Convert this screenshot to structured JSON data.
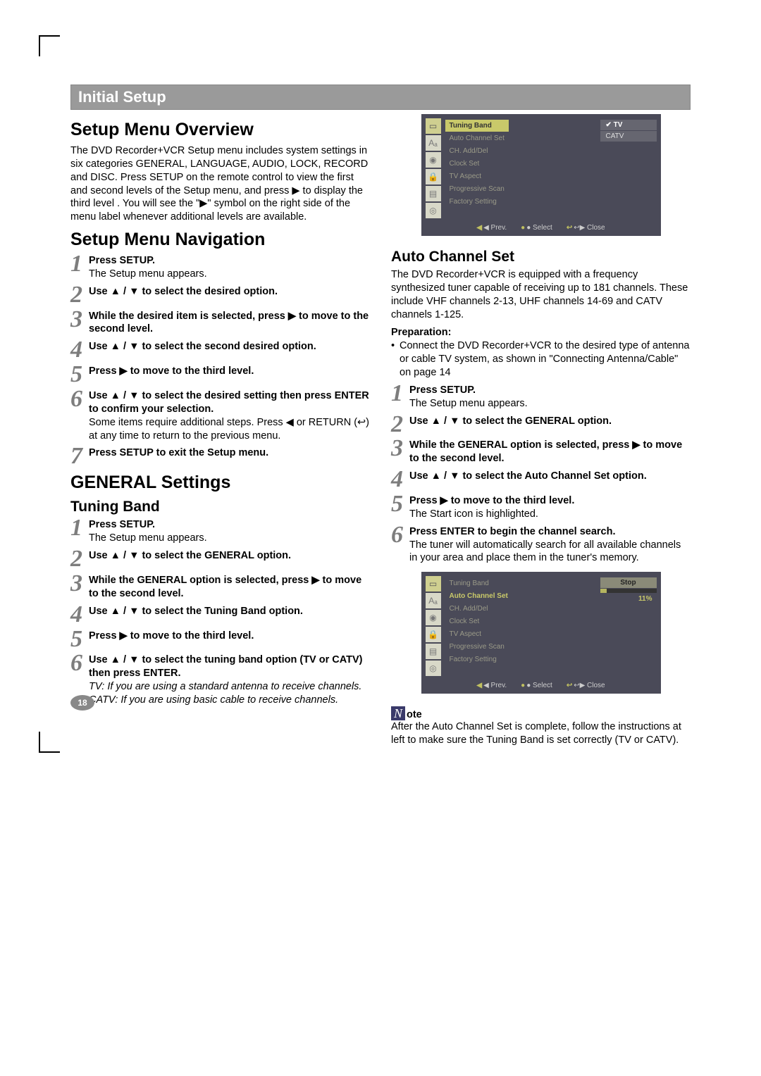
{
  "header": {
    "title": "Initial Setup"
  },
  "left": {
    "overview": {
      "heading": "Setup Menu Overview",
      "text": "The DVD Recorder+VCR Setup menu includes system settings in six categories GENERAL, LANGUAGE, AUDIO, LOCK, RECORD and DISC. Press SETUP on the remote control to view the first and second levels of the Setup menu, and press ▶ to display the third level . You will see the \"▶\" symbol on the right side of the menu label whenever additional levels are available."
    },
    "nav": {
      "heading": "Setup Menu Navigation",
      "steps": [
        {
          "n": "1",
          "bold": "Press SETUP.",
          "rest": "The Setup menu appears."
        },
        {
          "n": "2",
          "bold": "Use ▲ / ▼ to select the desired option."
        },
        {
          "n": "3",
          "bold": "While the desired item is selected, press ▶ to move to the second level."
        },
        {
          "n": "4",
          "bold": "Use ▲ / ▼ to select the second desired option."
        },
        {
          "n": "5",
          "bold": "Press ▶ to move to the third level."
        },
        {
          "n": "6",
          "bold": "Use ▲ / ▼ to select the desired setting then press ENTER to confirm your selection.",
          "rest": "Some items require additional steps. Press ◀ or RETURN (↩) at any time to return to the previous menu."
        },
        {
          "n": "7",
          "bold": "Press SETUP to exit the Setup menu."
        }
      ]
    },
    "general": {
      "heading": "GENERAL Settings",
      "sub": "Tuning Band",
      "steps": [
        {
          "n": "1",
          "bold": "Press SETUP.",
          "rest": "The Setup menu appears."
        },
        {
          "n": "2",
          "bold": "Use ▲ / ▼ to select the GENERAL option."
        },
        {
          "n": "3",
          "bold": "While the GENERAL option is selected, press ▶ to move to the second level."
        },
        {
          "n": "4",
          "bold": "Use ▲ / ▼ to select the Tuning Band option."
        },
        {
          "n": "5",
          "bold": "Press ▶ to move to the third level."
        },
        {
          "n": "6",
          "bold": "Use ▲ / ▼ to select the tuning band option (TV or CATV) then press ENTER.",
          "ital": "TV: If you are using a standard antenna to receive channels.\nCATV: If you are using basic cable to receive channels."
        }
      ]
    }
  },
  "right": {
    "osd1": {
      "items": [
        "Tuning Band",
        "Auto Channel Set",
        "CH. Add/Del",
        "Clock Set",
        "TV Aspect",
        "Progressive Scan",
        "Factory Setting"
      ],
      "highlight_index": 0,
      "options": [
        "TV",
        "CATV"
      ],
      "selected_option_index": 0,
      "footer": {
        "prev": "◀ Prev.",
        "select": "● Select",
        "close": "↩▶ Close"
      }
    },
    "autoset": {
      "heading": "Auto Channel Set",
      "text": "The DVD Recorder+VCR is equipped with a frequency synthesized tuner capable of receiving up to 181 channels. These include VHF channels 2-13, UHF channels 14-69 and CATV channels 1-125.",
      "prep_label": "Preparation:",
      "prep_item": "Connect the DVD Recorder+VCR to the desired type of antenna or cable TV system, as shown in \"Connecting Antenna/Cable\" on page 14",
      "steps": [
        {
          "n": "1",
          "bold": "Press SETUP.",
          "rest": "The Setup menu appears."
        },
        {
          "n": "2",
          "bold": "Use ▲ / ▼ to select the GENERAL option."
        },
        {
          "n": "3",
          "bold": "While the GENERAL option is selected, press ▶ to move to the second level."
        },
        {
          "n": "4",
          "bold": "Use ▲ / ▼ to select the Auto Channel Set option."
        },
        {
          "n": "5",
          "bold": "Press ▶ to move to the third level.",
          "rest": "The Start icon is highlighted."
        },
        {
          "n": "6",
          "bold": "Press ENTER to begin the channel search.",
          "rest": "The tuner will automatically search for all available channels in your area and place them in the tuner's memory."
        }
      ]
    },
    "osd2": {
      "items": [
        "Tuning Band",
        "Auto Channel Set",
        "CH. Add/Del",
        "Clock Set",
        "TV Aspect",
        "Progressive Scan",
        "Factory Setting"
      ],
      "highlight_index": 1,
      "stop_label": "Stop",
      "percent": "11%",
      "footer": {
        "prev": "◀ Prev.",
        "select": "● Select",
        "close": "↩▶ Close"
      }
    },
    "note": {
      "icon": "N",
      "label": "ote",
      "text": "After the Auto Channel Set is complete, follow the instructions at left to make sure the Tuning Band is set correctly (TV or CATV)."
    }
  },
  "page_number": "18"
}
